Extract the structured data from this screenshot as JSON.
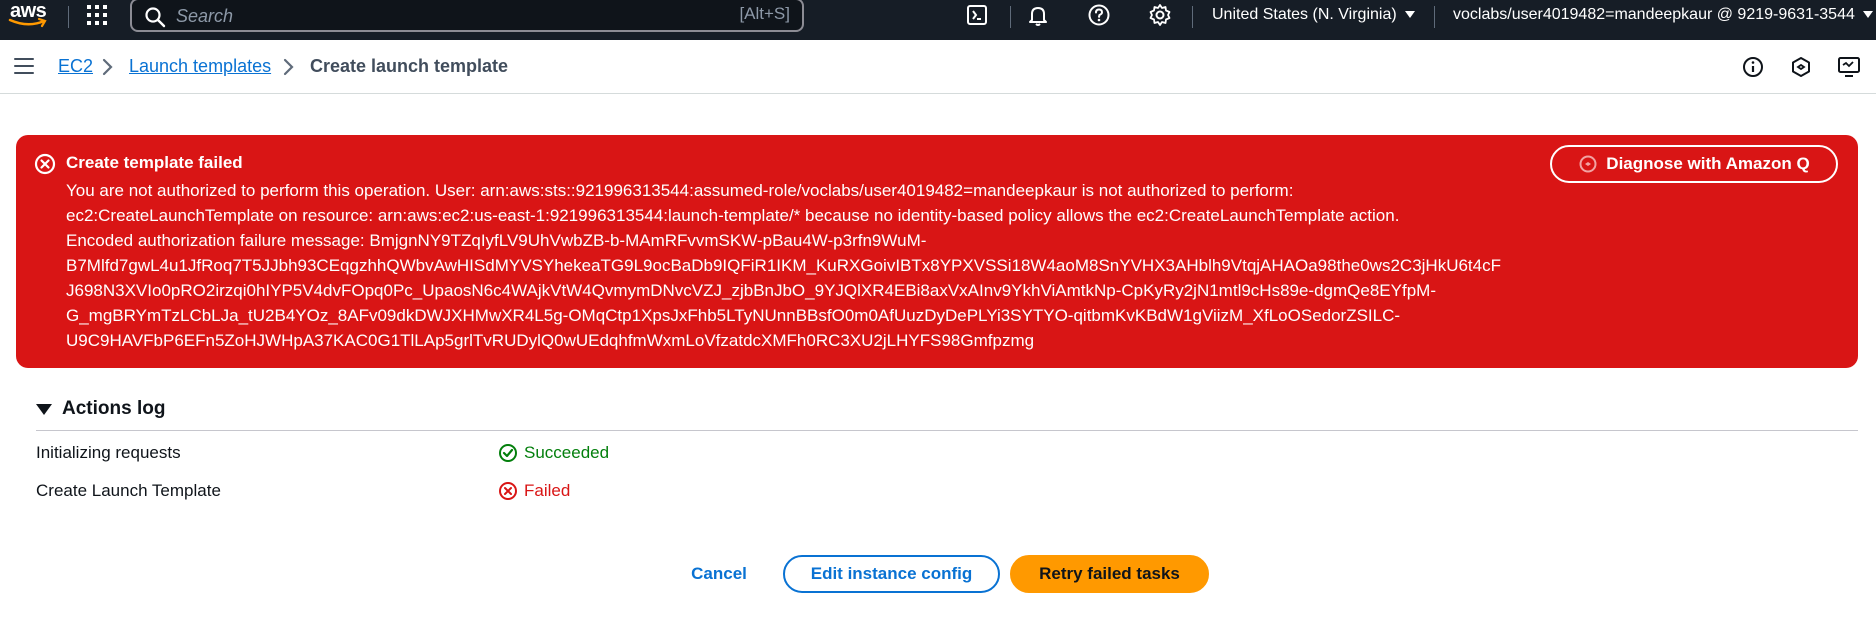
{
  "topnav": {
    "logo_text": "aws",
    "search_placeholder": "Search",
    "search_shortcut": "[Alt+S]",
    "region": "United States (N. Virginia)",
    "account": "voclabs/user4019482=mandeepkaur @ 9219-9631-3544",
    "icons": [
      "services-grid-icon",
      "cloudshell-icon",
      "bell-icon",
      "help-icon",
      "gear-icon"
    ]
  },
  "breadcrumb": {
    "items": [
      "EC2",
      "Launch templates"
    ],
    "current": "Create launch template"
  },
  "flash": {
    "type": "error",
    "title": "Create template failed",
    "lines": [
      "You are not authorized to perform this operation. User: arn:aws:sts::921996313544:assumed-role/voclabs/user4019482=mandeepkaur is not authorized to perform:",
      "ec2:CreateLaunchTemplate on resource: arn:aws:ec2:us-east-1:921996313544:launch-template/* because no identity-based policy allows the ec2:CreateLaunchTemplate action.",
      "Encoded authorization failure message: BmjgnNY9TZqIyfLV9UhVwbZB-b-MAmRFvvmSKW-pBau4W-p3rfn9WuM-",
      "B7Mlfd7gwL4u1JfRoq7T5JJbh93CEqgzhhQWbvAwHISdMYVSYhekeaTG9L9ocBaDb9IQFiR1IKM_KuRXGoivIBTx8YPXVSSi18W4aoM8SnYVHX3AHblh9VtqjAHAOa98the0ws2C3jHkU6t4cF",
      "J698N3XVIo0pRO2irzqi0hIYP5V4dvFOpq0Pc_UpaosN6c4WAjkVtW4QvmymDNvcVZJ_zjbBnJbO_9YJQlXR4EBi8axVxAInv9YkhViAmtkNp-CpKyRy2jN1mtl9cHs89e-dgmQe8EYfpM-",
      "G_mgBRYmTzLCbLJa_tU2B4YOz_8AFv09dkDWJXHMwXR4L5g-OMqCtp1XpsJxFhb5LTyNUnnBBsfO0m0AfUuzDyDePLYi3SYTYO-qitbmKvKBdW1gViizM_XfLoOSedorZSILC-",
      "U9C9HAVFbP6EFn5ZoHJWHpA37KAC0G1TlLAp5grlTvRUDylQ0wUEdqhfmWxmLoVfzatdcXMFh0RC3XU2jLHYFS98Gmfpzmg"
    ],
    "action_label": "Diagnose with Amazon Q"
  },
  "actions_log": {
    "title": "Actions log",
    "rows": [
      {
        "name": "Initializing requests",
        "status": "Succeeded",
        "state": "success"
      },
      {
        "name": "Create Launch Template",
        "status": "Failed",
        "state": "error"
      }
    ]
  },
  "footer": {
    "cancel_label": "Cancel",
    "edit_label": "Edit instance config",
    "retry_label": "Retry failed tasks"
  },
  "colors": {
    "nav_bg": "#161d26",
    "error_red": "#d91515",
    "success_green": "#037f0c",
    "link_blue": "#0972d3",
    "primary_orange": "#ff9900"
  }
}
